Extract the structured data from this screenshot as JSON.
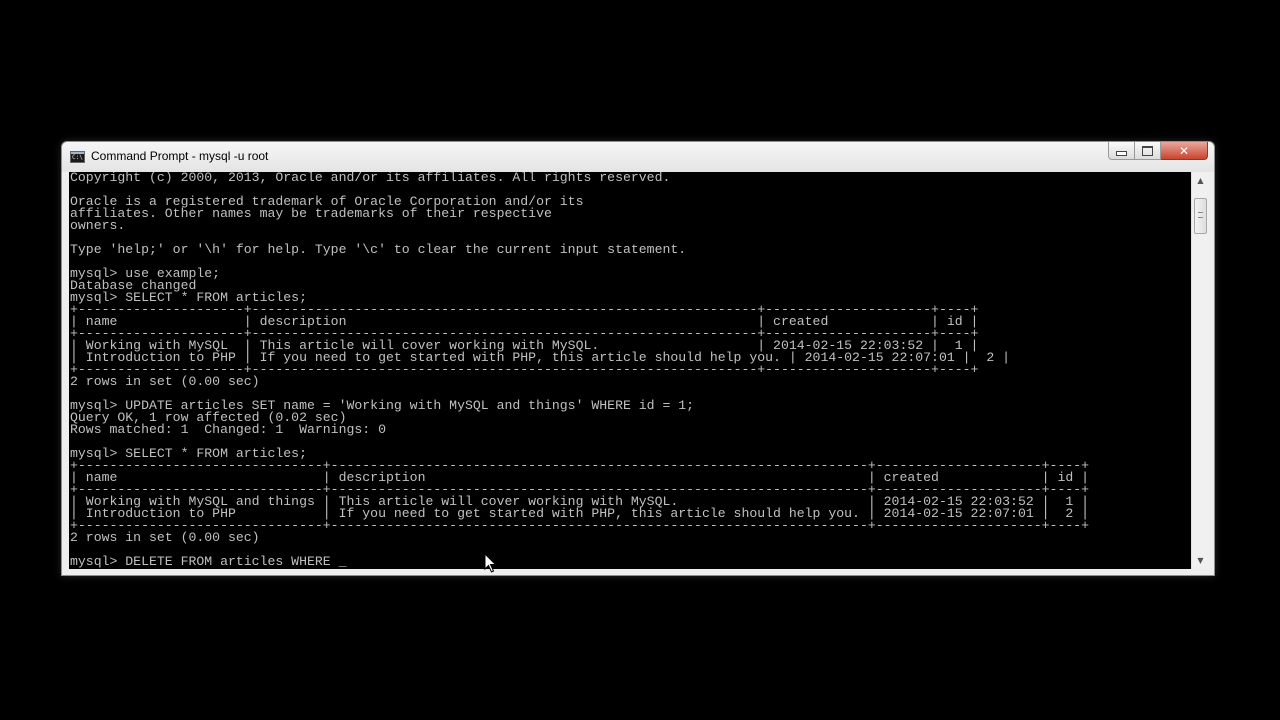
{
  "window": {
    "title": "Command Prompt - mysql  -u root",
    "controls": {
      "minimize": "",
      "maximize": "",
      "close": "✕"
    }
  },
  "terminal": {
    "lines": [
      "Copyright (c) 2000, 2013, Oracle and/or its affiliates. All rights reserved.",
      "",
      "Oracle is a registered trademark of Oracle Corporation and/or its",
      "affiliates. Other names may be trademarks of their respective",
      "owners.",
      "",
      "Type 'help;' or '\\h' for help. Type '\\c' to clear the current input statement.",
      "",
      "mysql> use example;",
      "Database changed",
      "mysql> SELECT * FROM articles;",
      "+---------------------+----------------------------------------------------------------+---------------------+----+",
      "| name                | description                                                    | created             | id |",
      "+---------------------+----------------------------------------------------------------+---------------------+----+",
      "| Working with MySQL  | This article will cover working with MySQL.                    | 2014-02-15 22:03:52 |  1 |",
      "| Introduction to PHP | If you need to get started with PHP, this article should help you. | 2014-02-15 22:07:01 |  2 |",
      "+---------------------+----------------------------------------------------------------+---------------------+----+",
      "2 rows in set (0.00 sec)",
      "",
      "mysql> UPDATE articles SET name = 'Working with MySQL and things' WHERE id = 1;",
      "Query OK, 1 row affected (0.02 sec)",
      "Rows matched: 1  Changed: 1  Warnings: 0",
      "",
      "mysql> SELECT * FROM articles;",
      "+-------------------------------+--------------------------------------------------------------------+---------------------+----+",
      "| name                          | description                                                        | created             | id |",
      "+-------------------------------+--------------------------------------------------------------------+---------------------+----+",
      "| Working with MySQL and things | This article will cover working with MySQL.                        | 2014-02-15 22:03:52 |  1 |",
      "| Introduction to PHP           | If you need to get started with PHP, this article should help you. | 2014-02-15 22:07:01 |  2 |",
      "+-------------------------------+--------------------------------------------------------------------+---------------------+----+",
      "2 rows in set (0.00 sec)",
      ""
    ],
    "current_prompt": "mysql> DELETE FROM articles WHERE ",
    "cursor": "_"
  },
  "scrollbar": {
    "up_arrow": "▲",
    "down_arrow": "▼"
  }
}
